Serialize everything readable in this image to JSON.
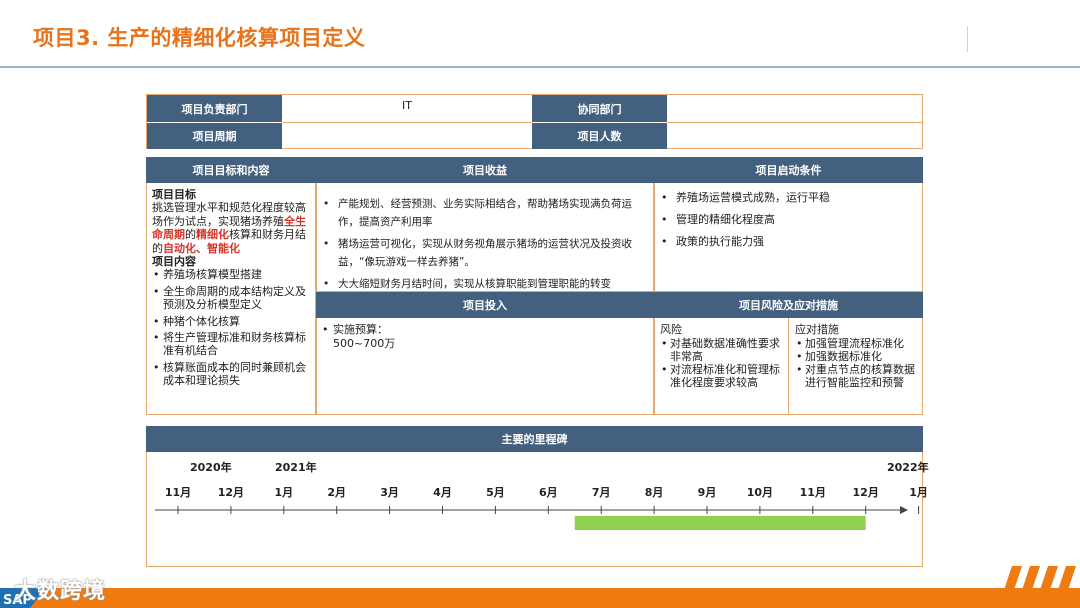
{
  "page": {
    "title": "项目3. 生产的精细化核算项目定义"
  },
  "info_table": {
    "dept_label": "项目负责部门",
    "dept_value": "IT",
    "coop_label": "协同部门",
    "coop_value": "",
    "period_label": "项目周期",
    "period_value": "",
    "headcount_label": "项目人数",
    "headcount_value": ""
  },
  "goals": {
    "header": "项目目标和内容",
    "goal_title": "项目目标",
    "goal_text_1": "挑选管理水平和规范化程度较高场作为试点，实现猪场养殖",
    "goal_red_1": "全生命周期",
    "goal_text_2": "的",
    "goal_red_2": "精细化",
    "goal_text_3": "核算和财务月结的",
    "goal_red_3": "自动化、智能化",
    "content_title": "项目内容",
    "content_items": [
      "养殖场核算模型搭建",
      "全生命周期的成本结构定义及预测及分析模型定义",
      "种猪个体化核算",
      "将生产管理标准和财务核算标准有机结合",
      "核算账面成本的同时兼顾机会成本和理论损失"
    ]
  },
  "benefits": {
    "header": "项目收益",
    "items": [
      "产能规划、经营预测、业务实际相结合，帮助猪场实现满负荷运作，提高资产利用率",
      "猪场运营可视化，实现从财务视角展示猪场的运营状况及投资收益，“像玩游戏一样去养猪”。",
      "大大缩短财务月结时间，实现从核算职能到管理职能的转变"
    ]
  },
  "start_conditions": {
    "header": "项目启动条件",
    "items": [
      "养殖场运营模式成熟，运行平稳",
      "管理的精细化程度高",
      "政策的执行能力强"
    ]
  },
  "investment": {
    "header": "项目投入",
    "budget_label": "实施预算：",
    "budget_value": "500~700万"
  },
  "risks": {
    "header": "项目风险及应对措施",
    "risk_title": "风险",
    "risk_items": [
      "对基础数据准确性要求非常高",
      "对流程标准化和管理标准化程度要求较高"
    ],
    "measure_title": "应对措施",
    "measure_items": [
      "加强管理流程标准化",
      "加强数据标准化",
      "对重点节点的核算数据进行智能监控和预警"
    ]
  },
  "milestones": {
    "header": "主要的里程碑",
    "years": [
      "2020年",
      "2021年",
      "2022年"
    ],
    "months": [
      "11月",
      "12月",
      "1月",
      "2月",
      "3月",
      "4月",
      "5月",
      "6月",
      "7月",
      "8月",
      "9月",
      "10月",
      "11月",
      "12月",
      "1月"
    ],
    "bar": {
      "start_month_index": 8,
      "end_month_index": 13.5,
      "color": "#92d050"
    }
  },
  "branding": {
    "watermark": "大数跨境",
    "logo_text": "SAP",
    "accent": "#ef7b10",
    "header_color": "#44607f"
  }
}
